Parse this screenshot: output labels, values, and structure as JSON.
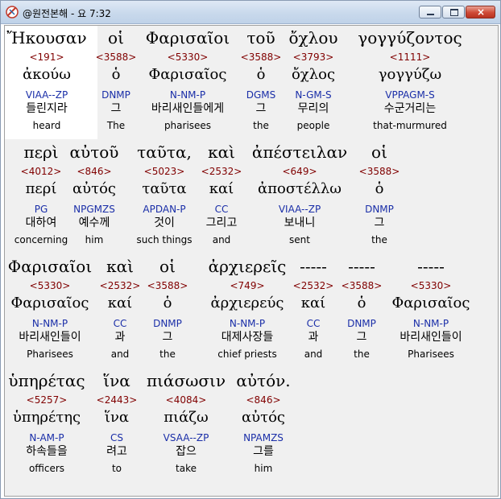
{
  "window": {
    "title": "@원전본해 - 요 7:32",
    "icon": "app-logo-icon",
    "controls": {
      "minimize": "minimize-icon",
      "maximize": "maximize-icon",
      "close": "×"
    }
  },
  "rows": [
    {
      "words": [
        {
          "greek": "Ἤκουσαν",
          "strong": "<191>",
          "lemma": "ἀκούω",
          "morph": "VIAA--ZP",
          "korean": "들린지라",
          "english": "heard",
          "highlight": true
        },
        {
          "greek": "οἱ",
          "strong": "<3588>",
          "lemma": "ὁ",
          "morph": "DNMP",
          "korean": "그",
          "english": "The"
        },
        {
          "greek": "Φαρισαῖοι",
          "strong": "<5330>",
          "lemma": "Φαρισαῖος",
          "morph": "N-NM-P",
          "korean": "바리새인들에게",
          "english": "pharisees"
        },
        {
          "greek": "τοῦ",
          "strong": "<3588>",
          "lemma": "ὁ",
          "morph": "DGMS",
          "korean": "그",
          "english": "the"
        },
        {
          "greek": "ὄχλου",
          "strong": "<3793>",
          "lemma": "ὄχλος",
          "morph": "N-GM-S",
          "korean": "무리의",
          "english": "people"
        },
        {
          "greek": "γογγύζοντος",
          "strong": "<1111>",
          "lemma": "γογγύζω",
          "morph": "VPPAGM-S",
          "korean": "수군거리는",
          "english": "that-murmured"
        }
      ]
    },
    {
      "words": [
        {
          "greek": "περὶ",
          "strong": "<4012>",
          "lemma": "περί",
          "morph": "PG",
          "korean": "대하여",
          "english": "concerning"
        },
        {
          "greek": "αὐτοῦ",
          "strong": "<846>",
          "lemma": "αὐτός",
          "morph": "NPGMZS",
          "korean": "예수께",
          "english": "him"
        },
        {
          "greek": "ταῦτα,",
          "strong": "<5023>",
          "lemma": "ταῦτα",
          "morph": "APDAN-P",
          "korean": "것이",
          "english": "such things"
        },
        {
          "greek": "καὶ",
          "strong": "<2532>",
          "lemma": "καί",
          "morph": "CC",
          "korean": "그리고",
          "english": "and"
        },
        {
          "greek": "ἀπέστειλαν",
          "strong": "<649>",
          "lemma": "ἀποστέλλω",
          "morph": "VIAA--ZP",
          "korean": "보내니",
          "english": "sent"
        },
        {
          "greek": "οἱ",
          "strong": "<3588>",
          "lemma": "ὁ",
          "morph": "DNMP",
          "korean": "그",
          "english": "the"
        }
      ]
    },
    {
      "words": [
        {
          "greek": "Φαρισαῖοι",
          "strong": "<5330>",
          "lemma": "Φαρισαῖος",
          "morph": "N-NM-P",
          "korean": "바리새인들이",
          "english": "Pharisees"
        },
        {
          "greek": "καὶ",
          "strong": "<2532>",
          "lemma": "καί",
          "morph": "CC",
          "korean": "과",
          "english": "and"
        },
        {
          "greek": "οἱ",
          "strong": "<3588>",
          "lemma": "ὁ",
          "morph": "DNMP",
          "korean": "그",
          "english": "the"
        },
        {
          "greek": "ἀρχιερεῖς",
          "strong": "<749>",
          "lemma": "ἀρχιερεύς",
          "morph": "N-NM-P",
          "korean": "대제사장들",
          "english": "chief priests"
        },
        {
          "greek": "-----",
          "strong": "<2532>",
          "lemma": "καί",
          "morph": "CC",
          "korean": "과",
          "english": "and"
        },
        {
          "greek": "-----",
          "strong": "<3588>",
          "lemma": "ὁ",
          "morph": "DNMP",
          "korean": "그",
          "english": "the"
        },
        {
          "greek": "-----",
          "strong": "<5330>",
          "lemma": "Φαρισαῖος",
          "morph": "N-NM-P",
          "korean": "바리새인들이",
          "english": "Pharisees"
        }
      ]
    },
    {
      "words": [
        {
          "greek": "ὑπηρέτας",
          "strong": "<5257>",
          "lemma": "ὑπηρέτης",
          "morph": "N-AM-P",
          "korean": "하속들을",
          "english": "officers"
        },
        {
          "greek": "ἵνα",
          "strong": "<2443>",
          "lemma": "ἵνα",
          "morph": "CS",
          "korean": "려고",
          "english": "to"
        },
        {
          "greek": "πιάσωσιν",
          "strong": "<4084>",
          "lemma": "πιάζω",
          "morph": "VSAA--ZP",
          "korean": "잡으",
          "english": "take"
        },
        {
          "greek": "αὐτόν.",
          "strong": "<846>",
          "lemma": "αὐτός",
          "morph": "NPAMZS",
          "korean": "그를",
          "english": "him"
        }
      ]
    }
  ]
}
